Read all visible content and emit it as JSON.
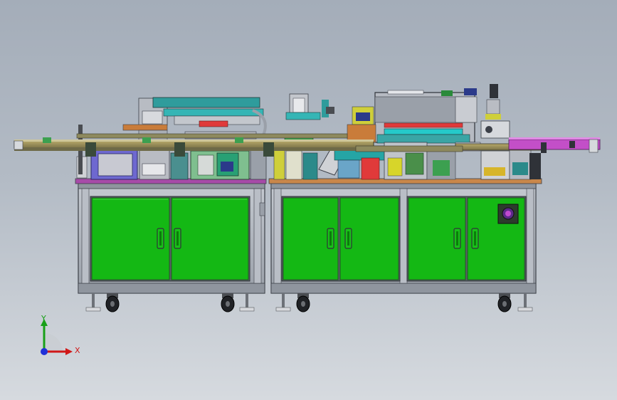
{
  "window": {
    "title": ""
  },
  "colors": {
    "background_top": "#a4adb9",
    "background_bottom": "#d6dadf",
    "cabinet_door_green": "#14b814",
    "cabinet_frame": "#a9afb8",
    "frame_dark": "#3c4048",
    "conveyor_magenta": "#c34fc8",
    "conveyor_olive": "#8e8a5e",
    "accent_cyan": "#25c9c9",
    "accent_teal": "#2f9c9c",
    "accent_red": "#e03a3a",
    "accent_yellow": "#d7d52a",
    "accent_orange": "#d08030",
    "top_plate_magenta": "#a74ba8",
    "panel_purple": "#8d7ddc",
    "axis_x": "#d01818",
    "axis_y": "#18a018",
    "axis_z": "#2030d8"
  },
  "icons": [
    "coordinate-triad-icon",
    "emergency-stop-icon",
    "door-handle-icon",
    "caster-wheel-icon",
    "leveling-foot-icon"
  ],
  "triad": {
    "x_label": "X",
    "y_label": "Y"
  }
}
